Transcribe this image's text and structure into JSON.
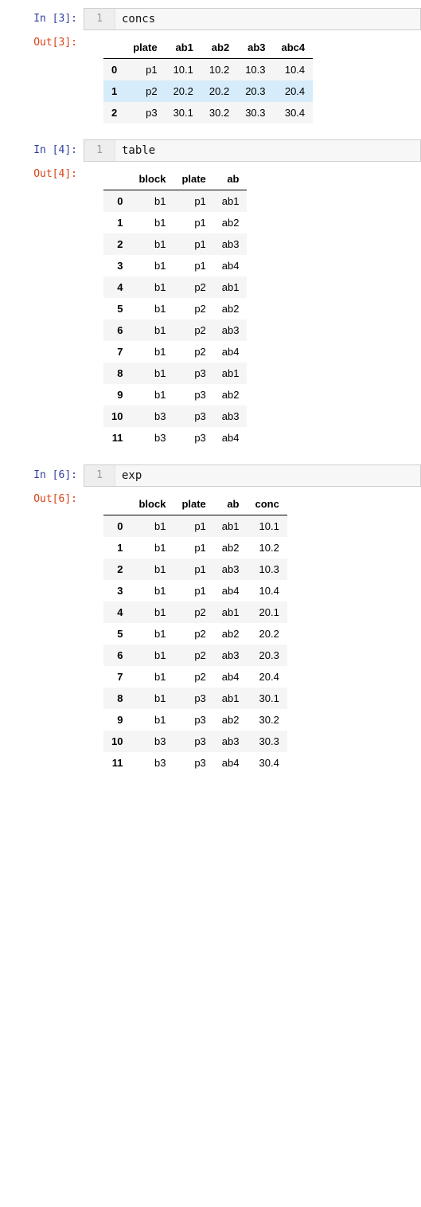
{
  "cells": [
    {
      "in_prompt": "In [3]:",
      "out_prompt": "Out[3]:",
      "gutter": "1",
      "code": "concs",
      "table": {
        "columns": [
          "plate",
          "ab1",
          "ab2",
          "ab3",
          "abc4"
        ],
        "index": [
          "0",
          "1",
          "2"
        ],
        "rows": [
          [
            "p1",
            "10.1",
            "10.2",
            "10.3",
            "10.4"
          ],
          [
            "p2",
            "20.2",
            "20.2",
            "20.3",
            "20.4"
          ],
          [
            "p3",
            "30.1",
            "30.2",
            "30.3",
            "30.4"
          ]
        ],
        "highlight_row": 1
      }
    },
    {
      "in_prompt": "In [4]:",
      "out_prompt": "Out[4]:",
      "gutter": "1",
      "code": "table",
      "table": {
        "columns": [
          "block",
          "plate",
          "ab"
        ],
        "index": [
          "0",
          "1",
          "2",
          "3",
          "4",
          "5",
          "6",
          "7",
          "8",
          "9",
          "10",
          "11"
        ],
        "rows": [
          [
            "b1",
            "p1",
            "ab1"
          ],
          [
            "b1",
            "p1",
            "ab2"
          ],
          [
            "b1",
            "p1",
            "ab3"
          ],
          [
            "b1",
            "p1",
            "ab4"
          ],
          [
            "b1",
            "p2",
            "ab1"
          ],
          [
            "b1",
            "p2",
            "ab2"
          ],
          [
            "b1",
            "p2",
            "ab3"
          ],
          [
            "b1",
            "p2",
            "ab4"
          ],
          [
            "b1",
            "p3",
            "ab1"
          ],
          [
            "b1",
            "p3",
            "ab2"
          ],
          [
            "b3",
            "p3",
            "ab3"
          ],
          [
            "b3",
            "p3",
            "ab4"
          ]
        ]
      }
    },
    {
      "in_prompt": "In [6]:",
      "out_prompt": "Out[6]:",
      "gutter": "1",
      "code": "exp",
      "table": {
        "columns": [
          "block",
          "plate",
          "ab",
          "conc"
        ],
        "index": [
          "0",
          "1",
          "2",
          "3",
          "4",
          "5",
          "6",
          "7",
          "8",
          "9",
          "10",
          "11"
        ],
        "rows": [
          [
            "b1",
            "p1",
            "ab1",
            "10.1"
          ],
          [
            "b1",
            "p1",
            "ab2",
            "10.2"
          ],
          [
            "b1",
            "p1",
            "ab3",
            "10.3"
          ],
          [
            "b1",
            "p1",
            "ab4",
            "10.4"
          ],
          [
            "b1",
            "p2",
            "ab1",
            "20.1"
          ],
          [
            "b1",
            "p2",
            "ab2",
            "20.2"
          ],
          [
            "b1",
            "p2",
            "ab3",
            "20.3"
          ],
          [
            "b1",
            "p2",
            "ab4",
            "20.4"
          ],
          [
            "b1",
            "p3",
            "ab1",
            "30.1"
          ],
          [
            "b1",
            "p3",
            "ab2",
            "30.2"
          ],
          [
            "b3",
            "p3",
            "ab3",
            "30.3"
          ],
          [
            "b3",
            "p3",
            "ab4",
            "30.4"
          ]
        ]
      }
    }
  ]
}
